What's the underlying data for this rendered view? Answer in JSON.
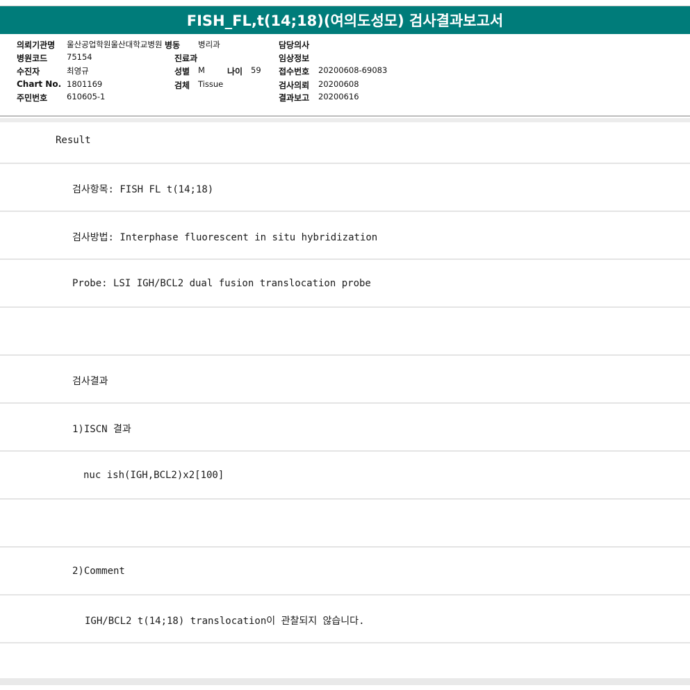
{
  "report": {
    "title": "FISH_FL,t(14;18)(여의도성모) 검사결과보고서"
  },
  "header": {
    "institution_label": "의뢰기관명",
    "institution_value": "울산공업학원울산대학교병원",
    "ward_label": "병동",
    "ward_value": "병리과",
    "physician_label": "담당의사",
    "physician_value": "",
    "hospital_code_label": "병원코드",
    "hospital_code_value": "75154",
    "department_label": "진료과",
    "department_value": "",
    "clinical_info_label": "임상정보",
    "clinical_info_value": "",
    "patient_label": "수진자",
    "patient_value": "최영규",
    "sex_label": "성별",
    "sex_value": "M",
    "age_label": "나이",
    "age_value": "59",
    "receipt_no_label": "접수번호",
    "receipt_no_value": "20200608-69083",
    "chart_no_label": "Chart No.",
    "chart_no_value": "1801169",
    "specimen_label": "검체",
    "specimen_value": "Tissue",
    "request_date_label": "검사의뢰",
    "request_date_value": "20200608",
    "resident_no_label": "주민번호",
    "resident_no_value": "610605-1",
    "report_date_label": "결과보고",
    "report_date_value": "20200616"
  },
  "result_lines": [
    "Result",
    "검사항목: FISH FL t(14;18)",
    "검사방법: Interphase fluorescent in situ hybridization",
    "Probe: LSI IGH/BCL2 dual fusion translocation probe",
    "",
    "검사결과",
    "1)ISCN 결과",
    "nuc ish(IGH,BCL2)x2[100]",
    "",
    "2)Comment",
    "IGH/BCL2 t(14;18) translocation이 관찰되지 않습니다.",
    ""
  ]
}
